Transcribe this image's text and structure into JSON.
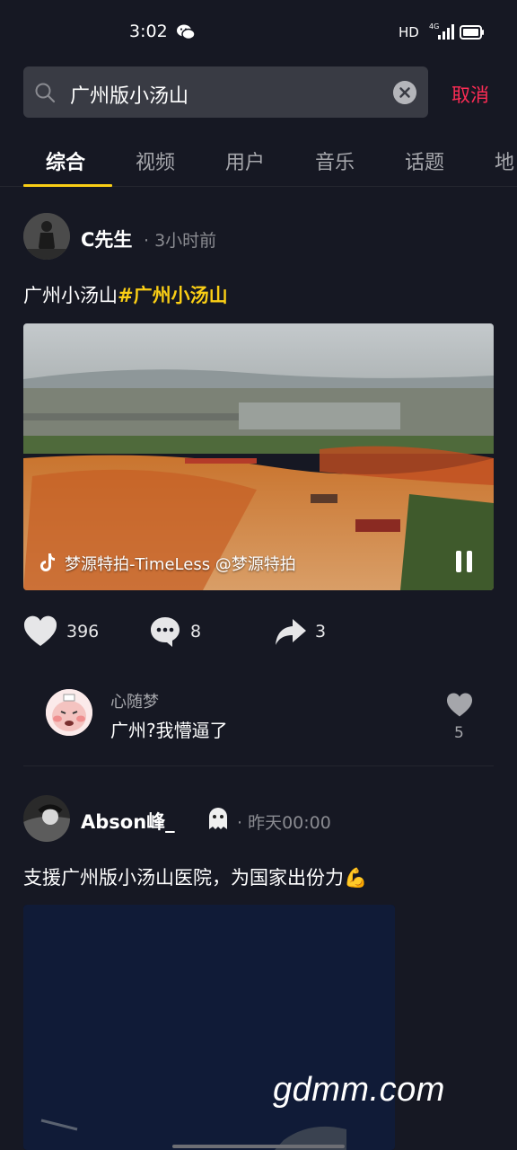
{
  "status_bar": {
    "time": "3:02",
    "network": "HD",
    "signal_label": "4G"
  },
  "search": {
    "query": "广州版小汤山",
    "cancel_label": "取消"
  },
  "tabs": [
    {
      "label": "综合",
      "active": true
    },
    {
      "label": "视频"
    },
    {
      "label": "用户"
    },
    {
      "label": "音乐"
    },
    {
      "label": "话题"
    },
    {
      "label": "地"
    }
  ],
  "posts": [
    {
      "author": "C先生",
      "time": "· 3小时前",
      "text": "广州小汤山",
      "hashtag": "#广州小汤山",
      "video_caption": "梦源特拍-TimeLess   @梦源特拍",
      "likes": "396",
      "comments": "8",
      "shares": "3",
      "top_comment": {
        "user": "心随梦",
        "text": "广州?我懵逼了",
        "likes": "5"
      }
    },
    {
      "author": "Abson峰_",
      "time": "· 昨天00:00",
      "text": "支援广州版小汤山医院，为国家出份力💪"
    }
  ],
  "watermark": "gdmm.com",
  "colors": {
    "background": "#161823",
    "accent": "#face15",
    "cancel": "#fe2c55"
  }
}
